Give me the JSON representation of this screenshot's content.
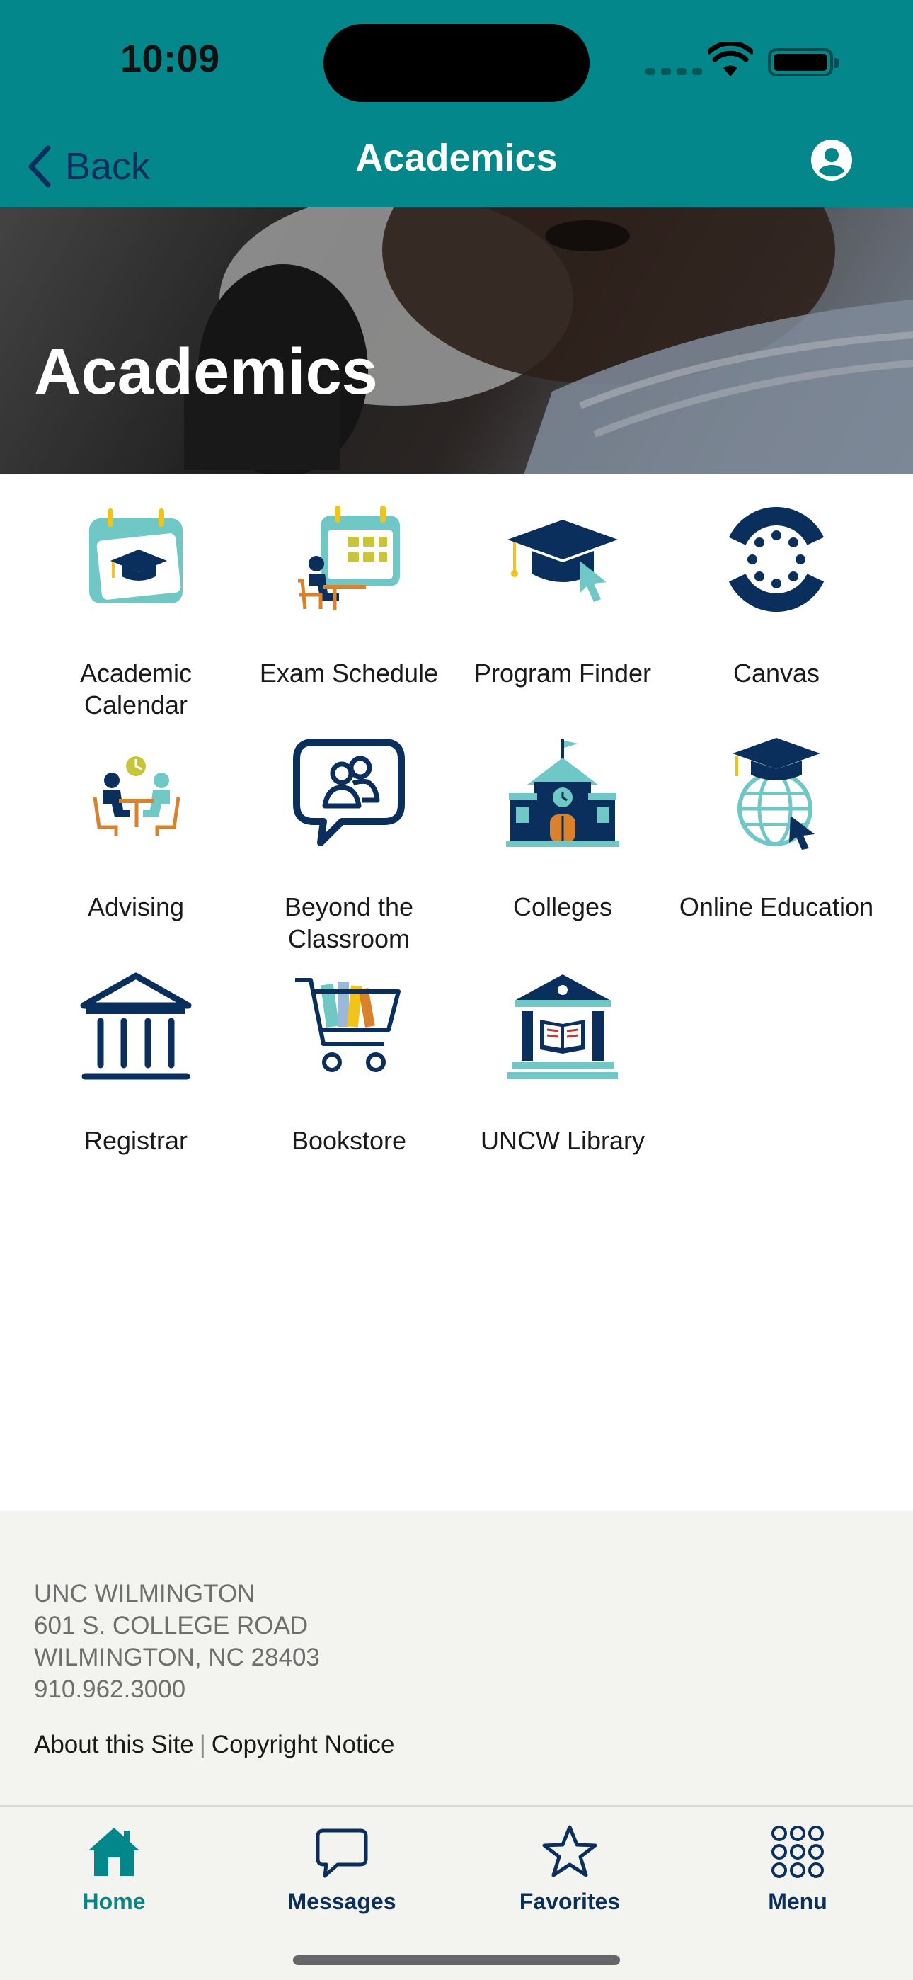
{
  "status_bar": {
    "time": "10:09"
  },
  "nav": {
    "back_label": "Back",
    "title": "Academics"
  },
  "hero": {
    "title": "Academics"
  },
  "tiles": [
    {
      "label": "Academic Calendar",
      "icon": "calendar-graduation-icon"
    },
    {
      "label": "Exam Schedule",
      "icon": "exam-schedule-icon"
    },
    {
      "label": "Program Finder",
      "icon": "graduation-cap-cursor-icon"
    },
    {
      "label": "Canvas",
      "icon": "canvas-logo-icon"
    },
    {
      "label": "Advising",
      "icon": "advising-meeting-icon"
    },
    {
      "label": "Beyond the Classroom",
      "icon": "chat-bubble-people-icon"
    },
    {
      "label": "Colleges",
      "icon": "schoolhouse-icon"
    },
    {
      "label": "Online Education",
      "icon": "globe-cap-icon"
    },
    {
      "label": "Registrar",
      "icon": "institution-columns-icon"
    },
    {
      "label": "Bookstore",
      "icon": "shopping-cart-books-icon"
    },
    {
      "label": "UNCW Library",
      "icon": "library-book-icon"
    }
  ],
  "footer": {
    "address_lines": [
      "UNC WILMINGTON",
      "601 S. COLLEGE ROAD",
      "WILMINGTON, NC 28403",
      "910.962.3000"
    ],
    "link_about": "About this Site",
    "link_separator": "|",
    "link_copyright": "Copyright Notice"
  },
  "tabbar": {
    "items": [
      {
        "label": "Home",
        "icon": "home-icon",
        "active": true
      },
      {
        "label": "Messages",
        "icon": "message-bubble-icon",
        "active": false
      },
      {
        "label": "Favorites",
        "icon": "star-icon",
        "active": false
      },
      {
        "label": "Menu",
        "icon": "grid-dots-icon",
        "active": false
      }
    ]
  },
  "colors": {
    "brand_teal": "#03878a",
    "navy": "#0b2f5c",
    "accent_teal_light": "#6fc7c6",
    "accent_gold": "#f0c419",
    "accent_orange": "#d9822b"
  }
}
